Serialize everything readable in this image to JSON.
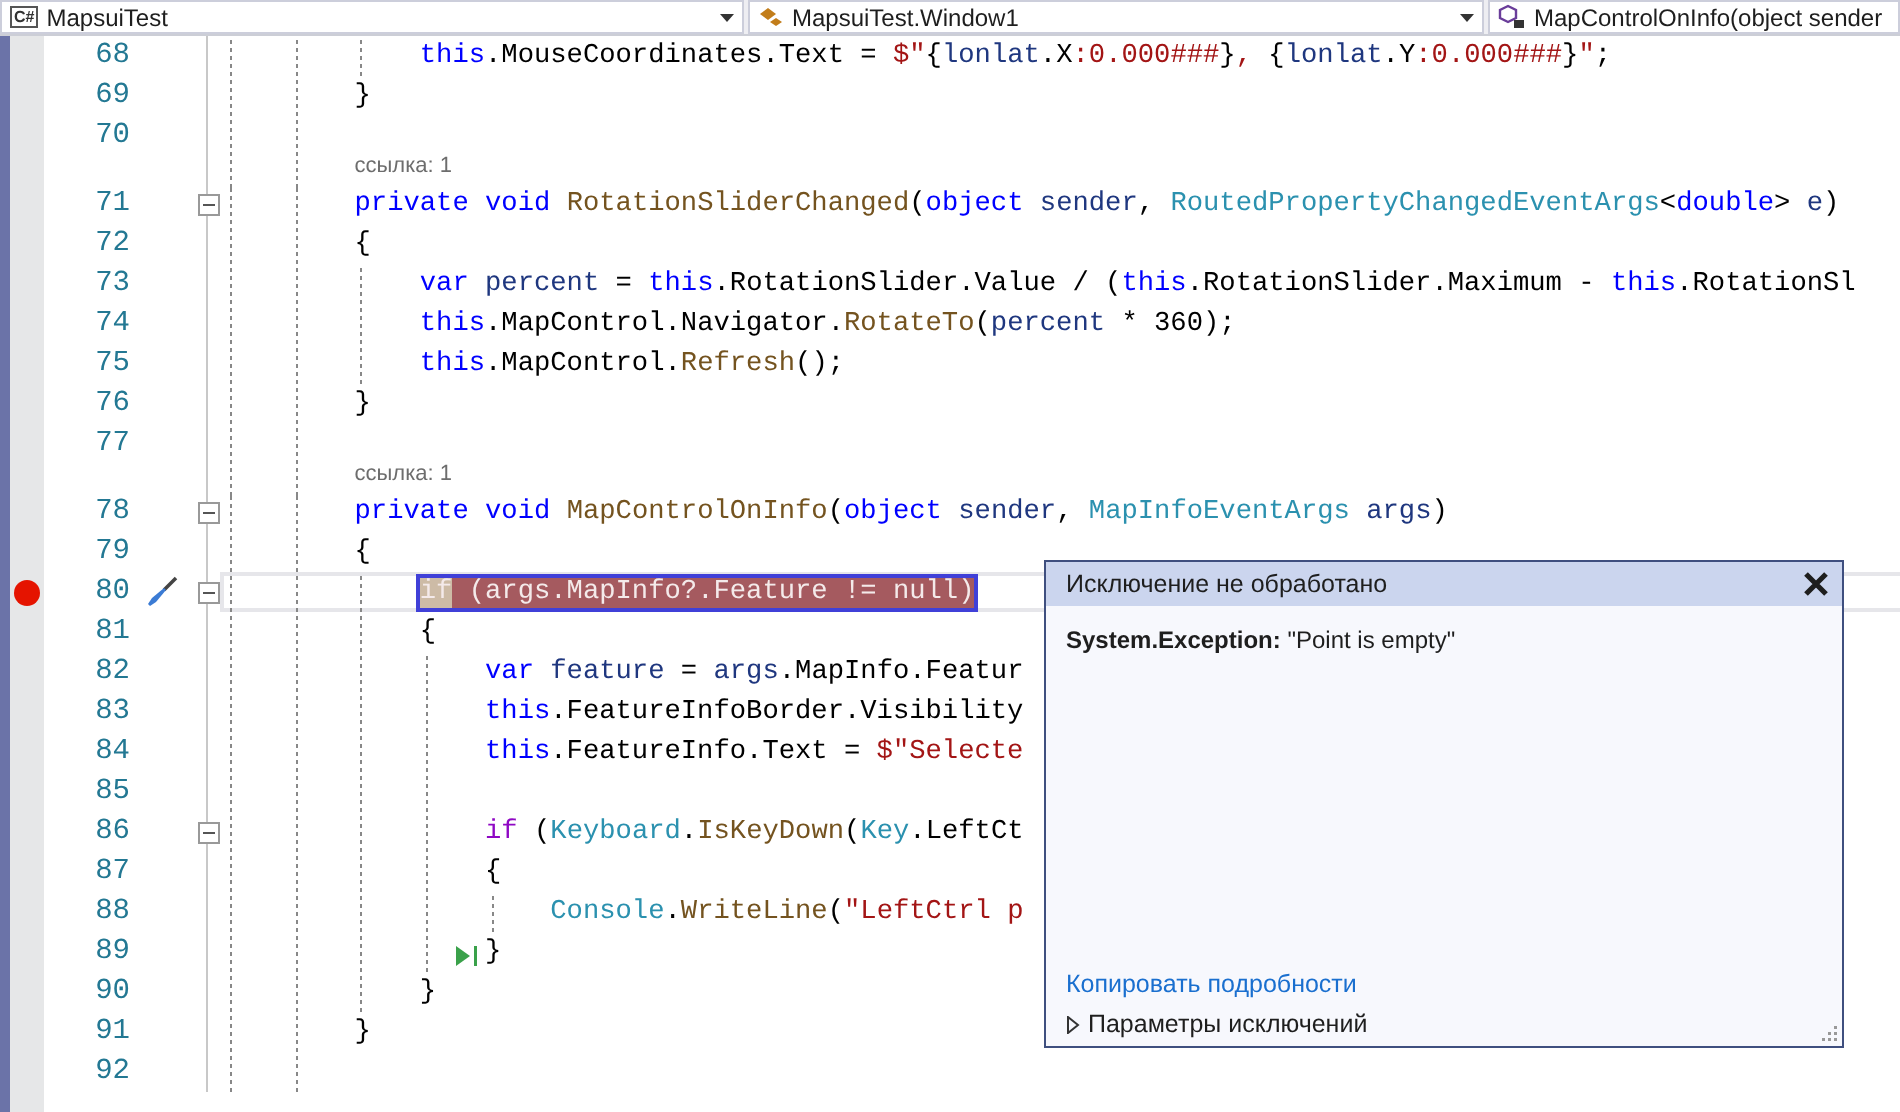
{
  "nav_bar": {
    "project": {
      "badge": "C#",
      "label": "MapsuiTest"
    },
    "class": {
      "label": "MapsuiTest.Window1"
    },
    "member": {
      "label": "MapControlOnInfo(object sender"
    }
  },
  "code_lines": [
    {
      "children": [
        {
          "number": "68",
          "tokens": [
            {
              "kind": "kw",
              "text": "this"
            },
            {
              "kind": "plain",
              "text": ".MouseCoordinates.Text = "
            },
            {
              "kind": "str",
              "text": "$\""
            },
            {
              "kind": "plain",
              "text": "{"
            },
            {
              "kind": "var",
              "text": "lonlat"
            },
            {
              "kind": "plain",
              "text": ".X"
            },
            {
              "kind": "str",
              "text": ":0.000###"
            },
            {
              "kind": "plain",
              "text": "}"
            },
            {
              "kind": "str",
              "text": ", "
            },
            {
              "kind": "plain",
              "text": "{"
            },
            {
              "kind": "var",
              "text": "lonlat"
            },
            {
              "kind": "plain",
              "text": ".Y"
            },
            {
              "kind": "str",
              "text": ":0.000###"
            },
            {
              "kind": "plain",
              "text": "}"
            },
            {
              "kind": "str",
              "text": "\""
            },
            {
              "kind": "plain",
              "text": ";"
            }
          ]
        }
      ]
    },
    {
      "number": "69",
      "tokens": [
        {
          "kind": "plain",
          "text": "}"
        }
      ]
    },
    {
      "number": "70"
    },
    {
      "number": "71",
      "codelens": "ссылка: 1",
      "expanded": true,
      "tokens": [
        {
          "kind": "kw",
          "text": "private void"
        },
        {
          "kind": "method",
          "text": " RotationSliderChanged"
        },
        {
          "kind": "plain",
          "text": "("
        },
        {
          "kind": "kw",
          "text": "object"
        },
        {
          "kind": "var",
          "text": " sender"
        },
        {
          "kind": "plain",
          "text": ", "
        },
        {
          "kind": "type",
          "text": "RoutedPropertyChangedEventArgs"
        },
        {
          "kind": "plain",
          "text": "<"
        },
        {
          "kind": "kw",
          "text": "double"
        },
        {
          "kind": "plain",
          "text": ">"
        },
        {
          "kind": "var",
          "text": " e"
        },
        {
          "kind": "plain",
          "text": ")"
        }
      ]
    },
    {
      "number": "72",
      "tokens": [
        {
          "kind": "plain",
          "text": "{"
        }
      ]
    },
    {
      "children": [
        {
          "number": "73",
          "tokens": [
            {
              "kind": "kw",
              "text": "var"
            },
            {
              "kind": "var",
              "text": " percent"
            },
            {
              "kind": "plain",
              "text": " = "
            },
            {
              "kind": "kw",
              "text": "this"
            },
            {
              "kind": "plain",
              "text": ".RotationSlider.Value / ("
            },
            {
              "kind": "kw",
              "text": "this"
            },
            {
              "kind": "plain",
              "text": ".RotationSlider.Maximum - "
            },
            {
              "kind": "kw",
              "text": "this"
            },
            {
              "kind": "plain",
              "text": ".RotationSl"
            }
          ]
        },
        {
          "number": "74",
          "tokens": [
            {
              "kind": "kw",
              "text": "this"
            },
            {
              "kind": "plain",
              "text": ".MapControl.Navigator."
            },
            {
              "kind": "method",
              "text": "RotateTo"
            },
            {
              "kind": "plain",
              "text": "("
            },
            {
              "kind": "var",
              "text": "percent"
            },
            {
              "kind": "plain",
              "text": " * 360);"
            }
          ]
        },
        {
          "number": "75",
          "tokens": [
            {
              "kind": "kw",
              "text": "this"
            },
            {
              "kind": "plain",
              "text": ".MapControl."
            },
            {
              "kind": "method",
              "text": "Refresh"
            },
            {
              "kind": "plain",
              "text": "();"
            }
          ]
        }
      ]
    },
    {
      "number": "76",
      "tokens": [
        {
          "kind": "plain",
          "text": "}"
        }
      ]
    },
    {
      "number": "77"
    },
    {
      "number": "78",
      "codelens": "ссылка: 1",
      "expanded": true,
      "tokens": [
        {
          "kind": "kw",
          "text": "private void"
        },
        {
          "kind": "method",
          "text": " MapControlOnInfo"
        },
        {
          "kind": "plain",
          "text": "("
        },
        {
          "kind": "kw",
          "text": "object"
        },
        {
          "kind": "var",
          "text": " sender"
        },
        {
          "kind": "plain",
          "text": ", "
        },
        {
          "kind": "type",
          "text": "MapInfoEventArgs"
        },
        {
          "kind": "var",
          "text": " args"
        },
        {
          "kind": "plain",
          "text": ")"
        }
      ]
    },
    {
      "number": "79",
      "tokens": [
        {
          "kind": "plain",
          "text": "{"
        }
      ]
    },
    {
      "children": [
        {
          "number": "80",
          "breakpoint": true,
          "current": true,
          "highlighted": true,
          "expanded": true,
          "tokens": [
            {
              "text": "if",
              "selected": true
            },
            {
              "text": " (args.MapInfo?.Feature != null)",
              "selected": false
            }
          ]
        },
        {
          "number": "81",
          "tokens": [
            {
              "kind": "plain",
              "text": "{"
            }
          ]
        },
        {
          "children": [
            {
              "number": "82",
              "tokens": [
                {
                  "kind": "kw",
                  "text": "var"
                },
                {
                  "kind": "var",
                  "text": " feature"
                },
                {
                  "kind": "plain",
                  "text": " = "
                },
                {
                  "kind": "var",
                  "text": "args"
                },
                {
                  "kind": "plain",
                  "text": ".MapInfo.Featur"
                }
              ]
            },
            {
              "number": "83",
              "tokens": [
                {
                  "kind": "kw",
                  "text": "this"
                },
                {
                  "kind": "plain",
                  "text": ".FeatureInfoBorder.Visibility"
                }
              ]
            },
            {
              "number": "84",
              "tokens": [
                {
                  "kind": "kw",
                  "text": "this"
                },
                {
                  "kind": "plain",
                  "text": ".FeatureInfo.Text = "
                },
                {
                  "kind": "str",
                  "text": "$\"Selecte"
                }
              ]
            },
            {
              "number": "85"
            },
            {
              "number": "86",
              "expanded": true,
              "tokens": [
                {
                  "kind": "ctl",
                  "text": "if"
                },
                {
                  "kind": "plain",
                  "text": " ("
                },
                {
                  "kind": "type",
                  "text": "Keyboard"
                },
                {
                  "kind": "plain",
                  "text": "."
                },
                {
                  "kind": "method",
                  "text": "IsKeyDown"
                },
                {
                  "kind": "plain",
                  "text": "("
                },
                {
                  "kind": "type",
                  "text": "Key"
                },
                {
                  "kind": "plain",
                  "text": ".LeftCt"
                }
              ]
            },
            {
              "number": "87",
              "tokens": [
                {
                  "kind": "plain",
                  "text": "{"
                }
              ]
            },
            {
              "children": [
                {
                  "number": "88",
                  "tokens": [
                    {
                      "kind": "type",
                      "text": "Console"
                    },
                    {
                      "kind": "plain",
                      "text": "."
                    },
                    {
                      "kind": "method",
                      "text": "WriteLine"
                    },
                    {
                      "kind": "plain",
                      "text": "("
                    },
                    {
                      "kind": "str",
                      "text": "\"LeftCtrl p"
                    }
                  ]
                }
              ]
            },
            {
              "number": "89",
              "run_to_cursor": true,
              "tokens": [
                {
                  "kind": "plain",
                  "text": "}"
                }
              ]
            }
          ]
        },
        {
          "number": "90",
          "tokens": [
            {
              "kind": "plain",
              "text": "}"
            }
          ]
        }
      ]
    },
    {
      "number": "91",
      "tokens": [
        {
          "kind": "plain",
          "text": "}"
        }
      ]
    },
    {
      "number": "92"
    }
  ],
  "exception_popup": {
    "title": "Исключение не обработано",
    "message": "**System.Exception:** \"Point is empty\"",
    "link": "Копировать подробности",
    "settings": {
      "label": "Параметры исключений",
      "expanded": false
    }
  }
}
